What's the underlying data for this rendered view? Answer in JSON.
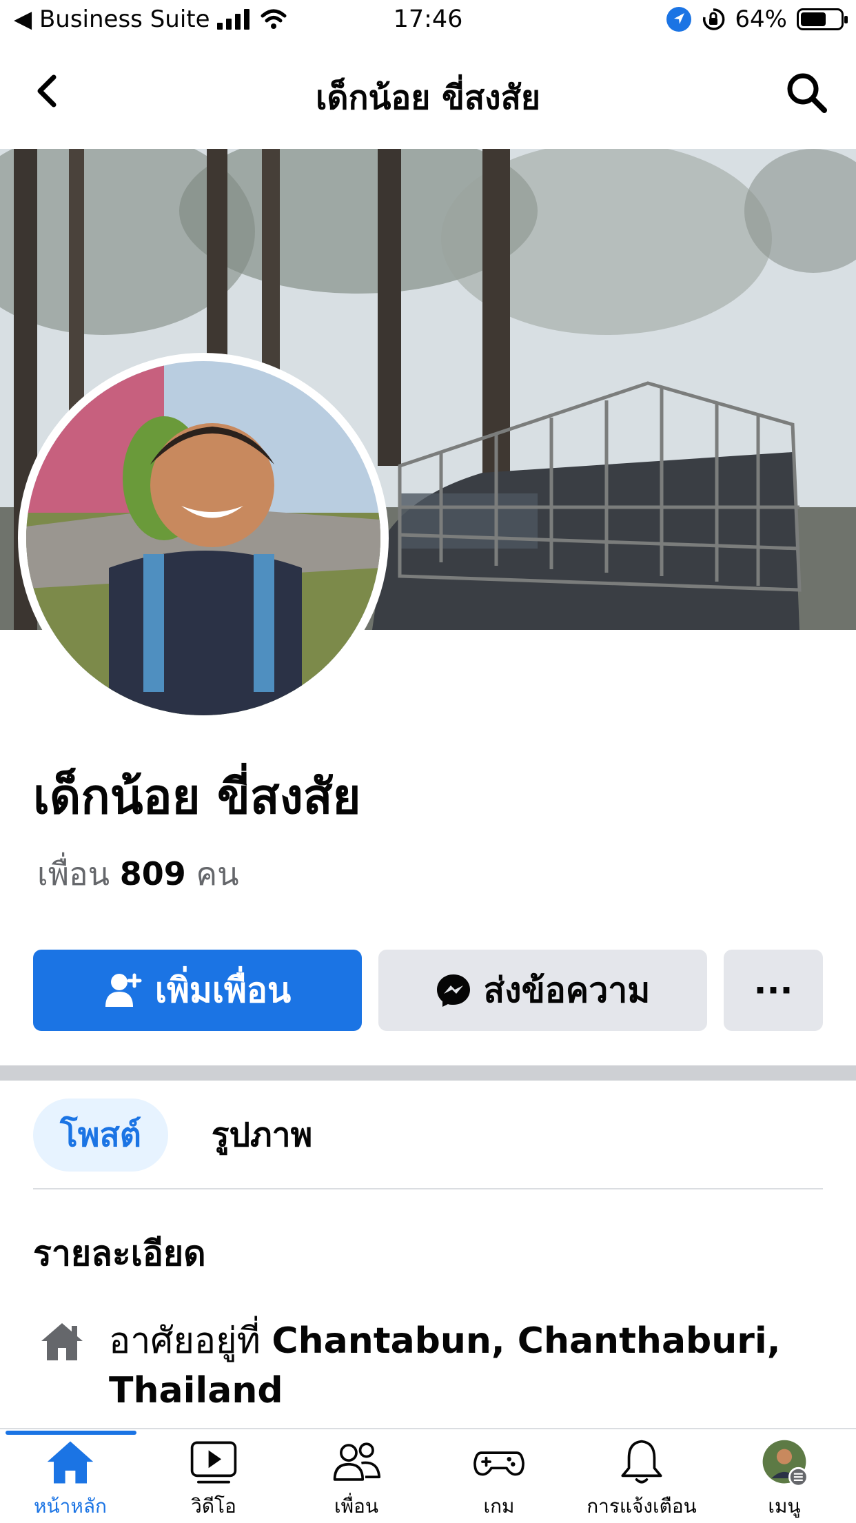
{
  "status_bar": {
    "carrier": "◀ Business Suite",
    "time": "17:46",
    "battery": "64%",
    "battery_level": 0.64
  },
  "nav": {
    "title": "เด็กน้อย ขี่สงสัย",
    "back_icon": "chevron-left-icon",
    "search_icon": "search-icon"
  },
  "profile": {
    "name": "เด็กน้อย ขี่สงสัย",
    "friends_prefix": "เพื่อน",
    "friends_count": "809",
    "friends_suffix": "คน"
  },
  "actions": {
    "add_friend": "เพิ่มเพื่อน",
    "message": "ส่งข้อความ",
    "more": "···"
  },
  "tabs": [
    {
      "label": "โพสต์",
      "active": true
    },
    {
      "label": "รูปภาพ",
      "active": false
    }
  ],
  "details": {
    "title": "รายละเอียด",
    "lives_prefix": "อาศัยอยู่ที่",
    "lives_location": "Chantabun, Chanthaburi, Thailand"
  },
  "tabbar": [
    {
      "label": "หน้าหลัก",
      "icon": "home-icon",
      "active": true
    },
    {
      "label": "วิดีโอ",
      "icon": "video-icon",
      "active": false
    },
    {
      "label": "เพื่อน",
      "icon": "friends-icon",
      "active": false
    },
    {
      "label": "เกม",
      "icon": "gaming-icon",
      "active": false
    },
    {
      "label": "การแจ้งเตือน",
      "icon": "bell-icon",
      "active": false
    },
    {
      "label": "เมนู",
      "icon": "menu-avatar-icon",
      "active": false
    }
  ],
  "colors": {
    "accent": "#1b74e4",
    "button_gray": "#e4e6eb",
    "text_secondary": "#65676b"
  }
}
